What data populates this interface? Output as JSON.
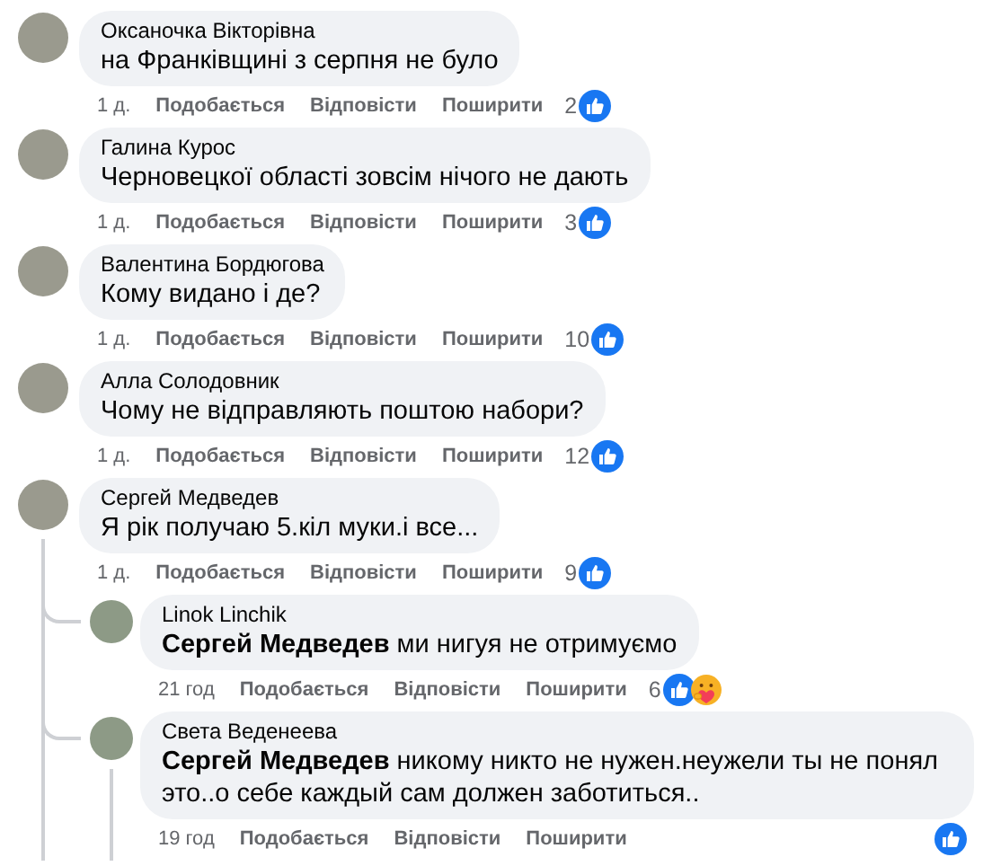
{
  "comments": [
    {
      "author": "Оксаночка Вікторівна",
      "text": "на Франківщині з серпня не було",
      "time": "1 д.",
      "actions": [
        "Подобається",
        "Відповісти",
        "Поширити"
      ],
      "reaction_count": "2",
      "reactions": [
        {
          "kind": "like"
        }
      ]
    },
    {
      "author": "Галина Курос",
      "text": "Черновецкої області зовсім нічого не дають",
      "time": "1 д.",
      "actions": [
        "Подобається",
        "Відповісти",
        "Поширити"
      ],
      "reaction_count": "3",
      "reactions": [
        {
          "kind": "like"
        }
      ]
    },
    {
      "author": "Валентина Бордюгова",
      "text": "Кому видано і де?",
      "time": "1 д.",
      "actions": [
        "Подобається",
        "Відповісти",
        "Поширити"
      ],
      "reaction_count": "10",
      "reactions": [
        {
          "kind": "like"
        }
      ]
    },
    {
      "author": "Алла Солодовник",
      "text": "Чому не відправляють поштою набори?",
      "time": "1 д.",
      "actions": [
        "Подобається",
        "Відповісти",
        "Поширити"
      ],
      "reaction_count": "12",
      "reactions": [
        {
          "kind": "like"
        }
      ]
    },
    {
      "author": "Сергей Медведев",
      "text": "Я рік получаю 5.кіл муки.і все...",
      "time": "1 д.",
      "actions": [
        "Подобається",
        "Відповісти",
        "Поширити"
      ],
      "reaction_count": "9",
      "reactions": [
        {
          "kind": "like"
        }
      ],
      "children": [
        {
          "author": "Linok Linchik",
          "text": "**Сергей Медведев** ми нигуя не отримуємо",
          "time": "21 год",
          "actions": [
            "Подобається",
            "Відповісти",
            "Поширити"
          ],
          "reaction_count": "6",
          "reactions": [
            {
              "kind": "like"
            },
            {
              "kind": "care"
            }
          ],
          "thread_continues": false
        },
        {
          "author": "Света Веденеева",
          "text": "**Сергей Медведев** никому никто не нужен.неужели ты не понял это..о себе каждый сам должен заботиться..",
          "time": "19 год",
          "actions": [
            "Подобається",
            "Відповісти",
            "Поширити"
          ],
          "reactions": [
            {
              "kind": "like"
            }
          ],
          "thread_continues": true
        }
      ]
    }
  ]
}
